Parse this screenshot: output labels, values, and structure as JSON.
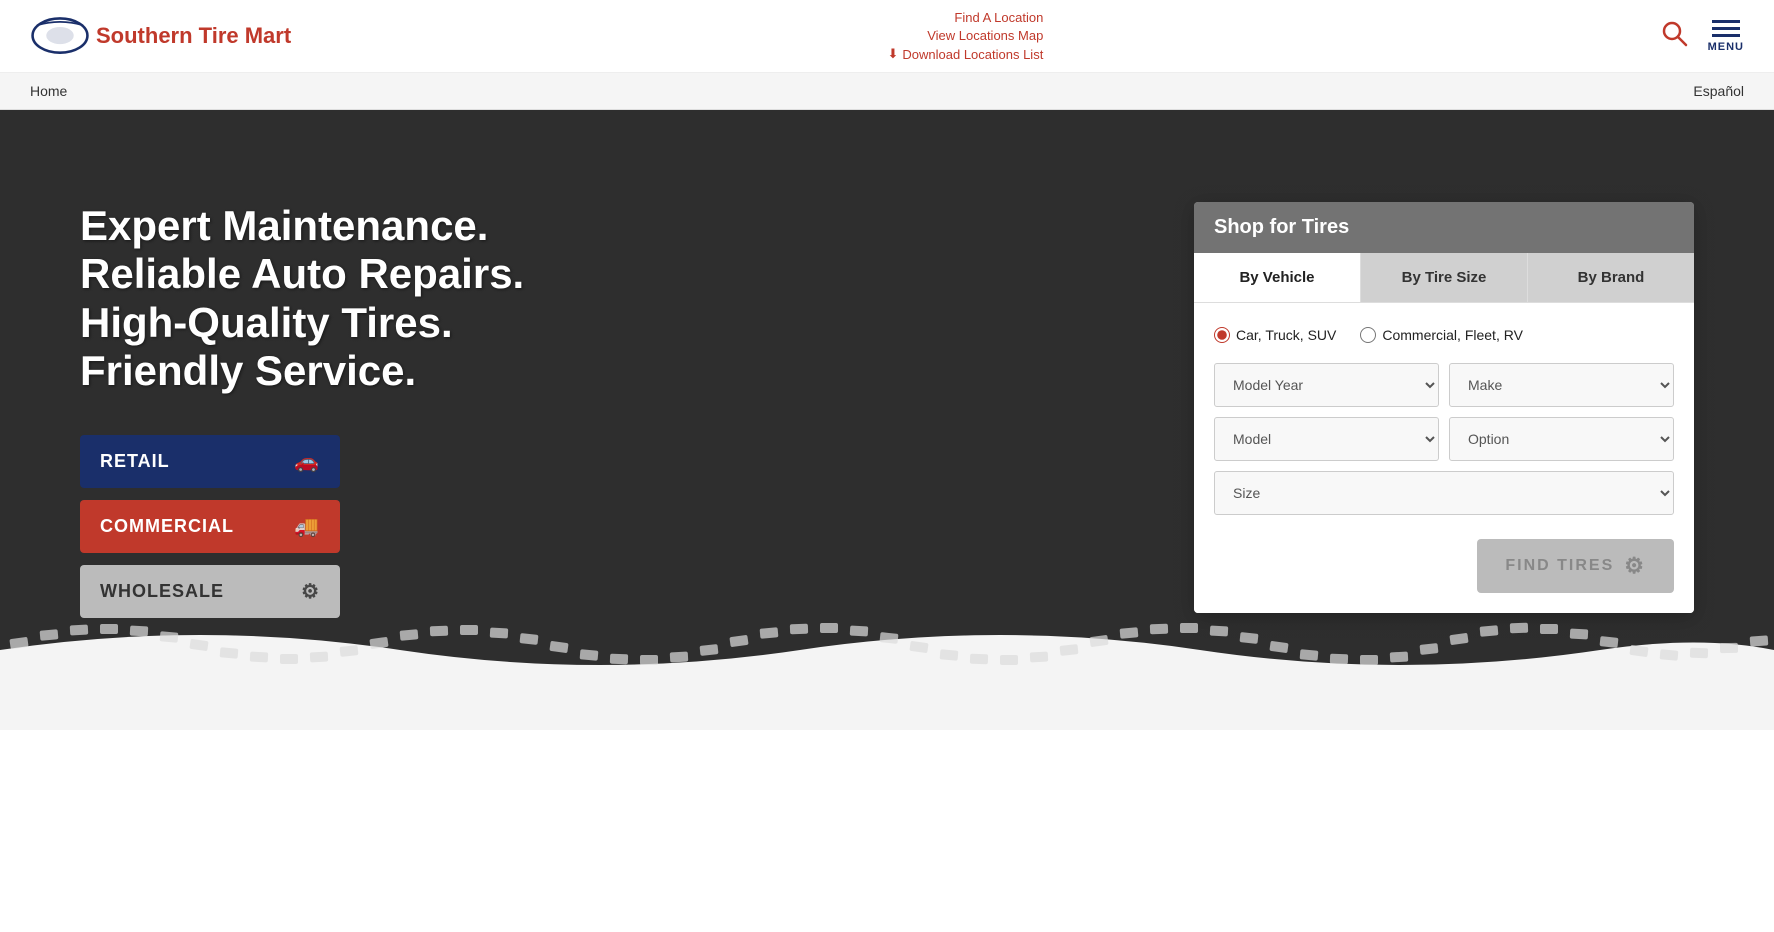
{
  "site": {
    "name": "Southern Tire Mart"
  },
  "header": {
    "links": {
      "find_location": "Find A Location",
      "view_map": "View Locations Map",
      "download_list": "Download Locations List"
    },
    "menu_label": "MENU"
  },
  "nav": {
    "home": "Home",
    "espanol": "Español"
  },
  "hero": {
    "headline_line1": "Expert Maintenance.",
    "headline_line2": "Reliable Auto Repairs.",
    "headline_line3": "High-Quality Tires.",
    "headline_line4": "Friendly Service.",
    "buttons": {
      "retail": "RETAIL",
      "commercial": "COMMERCIAL",
      "wholesale": "WHOLESALE"
    }
  },
  "shop": {
    "title": "Shop for Tires",
    "tabs": {
      "by_vehicle": "By Vehicle",
      "by_tire_size": "By Tire Size",
      "by_brand": "By Brand"
    },
    "radio": {
      "car_truck_suv": "Car, Truck, SUV",
      "commercial_fleet_rv": "Commercial, Fleet, RV"
    },
    "selects": {
      "model_year": "Model Year",
      "make": "Make",
      "model": "Model",
      "option": "Option",
      "size": "Size"
    },
    "find_tires_btn": "FIND TIRES"
  }
}
